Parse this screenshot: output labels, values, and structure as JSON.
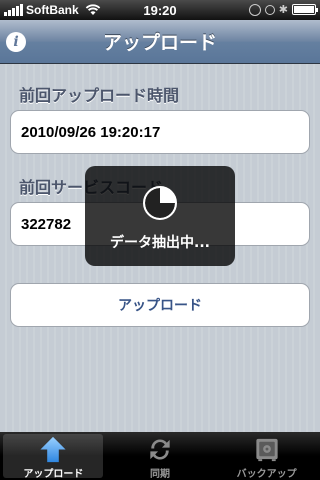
{
  "status_bar": {
    "carrier": "SoftBank",
    "time": "19:20",
    "battery_level": 1.0
  },
  "nav": {
    "title": "アップロード",
    "info_icon": "info-icon"
  },
  "form": {
    "last_upload_label": "前回アップロード時間",
    "last_upload_value": "2010/09/26 19:20:17",
    "last_service_label": "前回サービスコード",
    "last_service_value": "322782",
    "upload_button_label": "アップロード"
  },
  "hud": {
    "message": "データ抽出中...",
    "icon": "progress-pie-icon",
    "progress": 0.25
  },
  "tab_bar": {
    "tabs": [
      {
        "label": "アップロード",
        "icon": "upload-arrow-icon",
        "active": true
      },
      {
        "label": "同期",
        "icon": "sync-icon",
        "active": false
      },
      {
        "label": "バックアップ",
        "icon": "safe-icon",
        "active": false
      }
    ]
  },
  "colors": {
    "nav_bar": "#6d84a2",
    "label_text": "#4c566c",
    "button_text": "#385487",
    "tab_active_icon": "#3b9cf0"
  }
}
